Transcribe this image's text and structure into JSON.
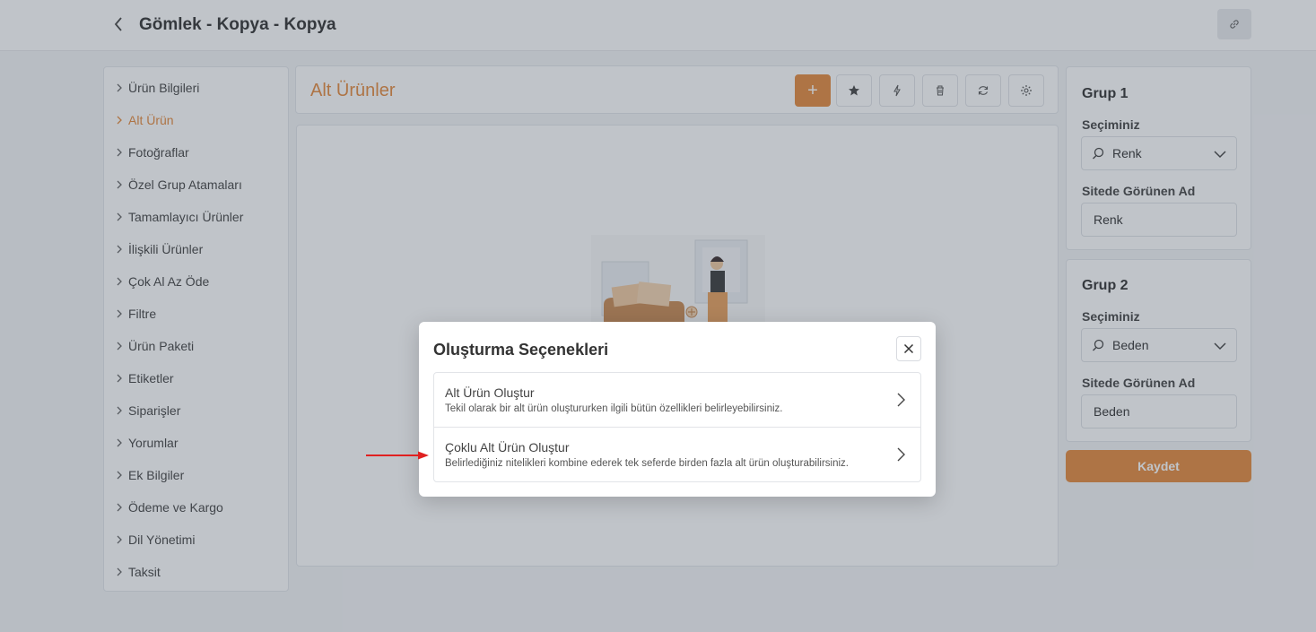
{
  "header": {
    "title": "Gömlek - Kopya - Kopya",
    "back_icon": "chevron-left-icon",
    "link_icon": "link-icon"
  },
  "sidebar": {
    "items": [
      {
        "label": "Ürün Bilgileri",
        "active": false
      },
      {
        "label": "Alt Ürün",
        "active": true
      },
      {
        "label": "Fotoğraflar",
        "active": false
      },
      {
        "label": "Özel Grup Atamaları",
        "active": false
      },
      {
        "label": "Tamamlayıcı Ürünler",
        "active": false
      },
      {
        "label": "İlişkili Ürünler",
        "active": false
      },
      {
        "label": "Çok Al Az Öde",
        "active": false
      },
      {
        "label": "Filtre",
        "active": false
      },
      {
        "label": "Ürün Paketi",
        "active": false
      },
      {
        "label": "Etiketler",
        "active": false
      },
      {
        "label": "Siparişler",
        "active": false
      },
      {
        "label": "Yorumlar",
        "active": false
      },
      {
        "label": "Ek Bilgiler",
        "active": false
      },
      {
        "label": "Ödeme ve Kargo",
        "active": false
      },
      {
        "label": "Dil Yönetimi",
        "active": false
      },
      {
        "label": "Taksit",
        "active": false
      }
    ]
  },
  "main": {
    "title": "Alt Ürünler",
    "toolbar": {
      "add_label": "+",
      "icons": [
        "plus-icon",
        "star-icon",
        "lightning-icon",
        "trash-icon",
        "refresh-icon",
        "gear-icon"
      ]
    }
  },
  "groups": [
    {
      "title": "Grup 1",
      "select_label": "Seçiminiz",
      "select_value": "Renk",
      "name_label": "Sitede Görünen Ad",
      "name_value": "Renk"
    },
    {
      "title": "Grup 2",
      "select_label": "Seçiminiz",
      "select_value": "Beden",
      "name_label": "Sitede Görünen Ad",
      "name_value": "Beden"
    }
  ],
  "save_label": "Kaydet",
  "modal": {
    "title": "Oluşturma Seçenekleri",
    "options": [
      {
        "title": "Alt Ürün Oluştur",
        "description": "Tekil olarak bir alt ürün oluştururken ilgili bütün özellikleri belirleyebilirsiniz."
      },
      {
        "title": "Çoklu Alt Ürün Oluştur",
        "description": "Belirlediğiniz nitelikleri kombine ederek tek seferde birden fazla alt ürün oluşturabilirsiniz."
      }
    ]
  },
  "colors": {
    "accent": "#e58a3d",
    "annotation_arrow": "#e02020"
  }
}
